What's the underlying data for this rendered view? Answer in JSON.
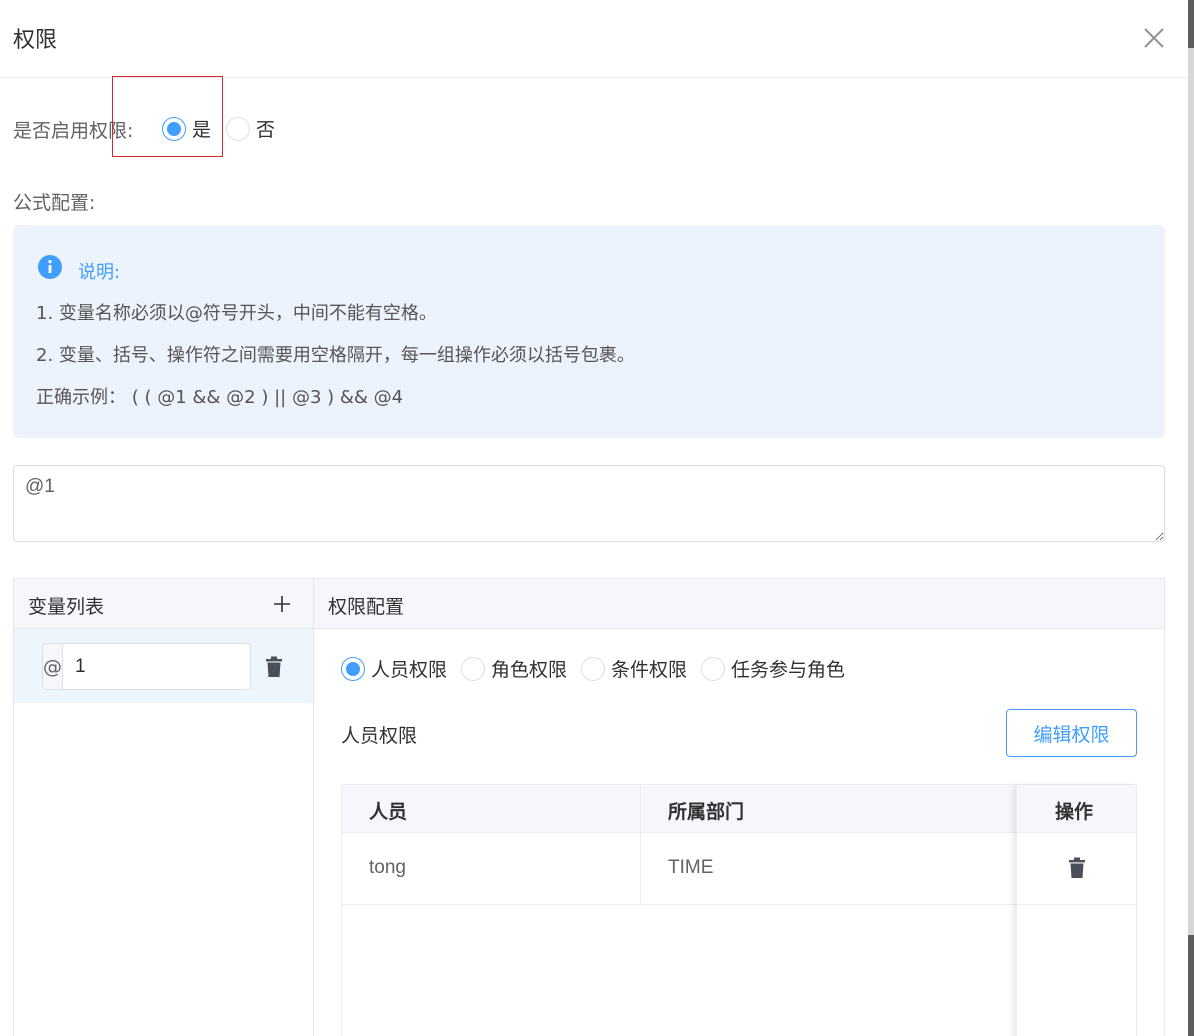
{
  "dialog": {
    "title": "权限"
  },
  "enable": {
    "label": "是否启用权限:",
    "options": [
      {
        "label": "是",
        "checked": true
      },
      {
        "label": "否",
        "checked": false
      }
    ]
  },
  "formula": {
    "label": "公式配置:",
    "alert": {
      "title": "说明:",
      "lines": [
        "1. 变量名称必须以@符号开头，中间不能有空格。",
        "2. 变量、括号、操作符之间需要用空格隔开，每一组操作必须以括号包裹。",
        "正确示例：  ( ( @1 && @2 ) || @3 ) && @4"
      ]
    },
    "value": "@1"
  },
  "variables": {
    "header": "变量列表",
    "items": [
      {
        "prefix": "@",
        "value": "1"
      }
    ]
  },
  "config": {
    "header": "权限配置",
    "types": [
      {
        "label": "人员权限",
        "checked": true
      },
      {
        "label": "角色权限",
        "checked": false
      },
      {
        "label": "条件权限",
        "checked": false
      },
      {
        "label": "任务参与角色",
        "checked": false
      }
    ],
    "section_title": "人员权限",
    "edit_label": "编辑权限",
    "table": {
      "columns": [
        "人员",
        "所属部门",
        "操作"
      ],
      "rows": [
        {
          "person": "tong",
          "dept": "TIME"
        }
      ]
    }
  },
  "colors": {
    "accent": "#409eff",
    "alert_bg": "#ecf3fc",
    "focus_outline": "#d0282e"
  }
}
